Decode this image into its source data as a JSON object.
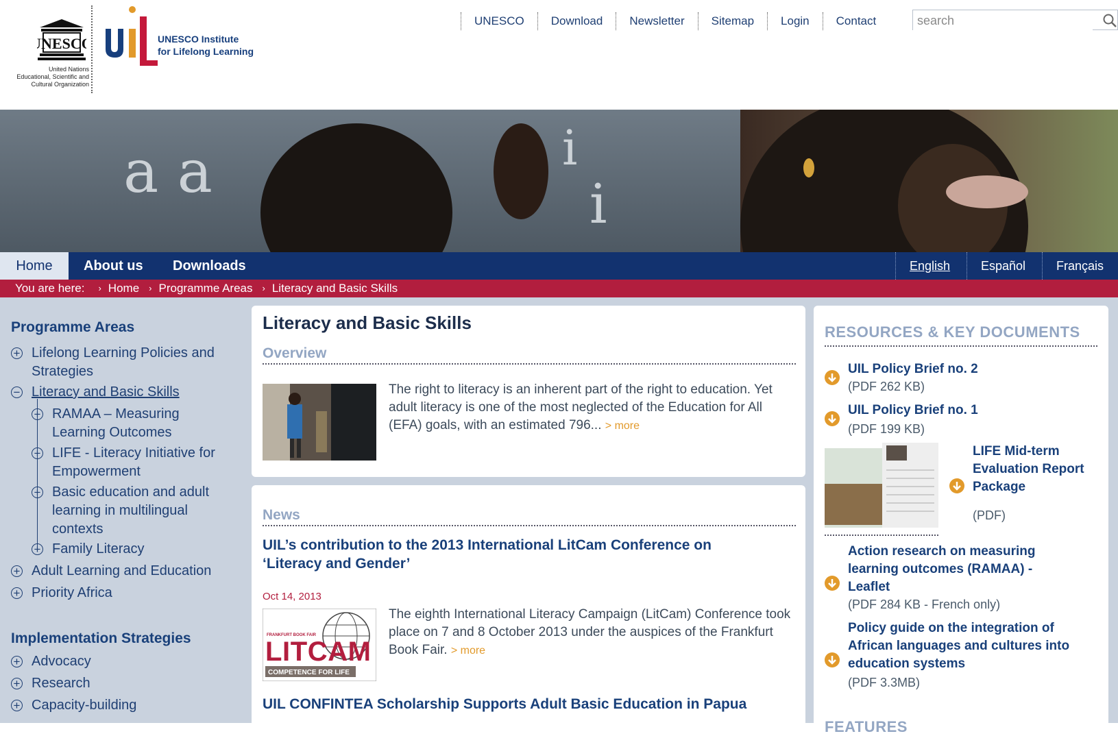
{
  "header": {
    "unesco_logo_text": "UNESCO",
    "unesco_subtitle": "United Nations\nEducational, Scientific and\nCultural Organization",
    "uil_logo_text": "uil",
    "uil_name": "UNESCO Institute\nfor Lifelong Learning",
    "topnav": [
      "UNESCO",
      "Download",
      "Newsletter",
      "Sitemap",
      "Login",
      "Contact"
    ],
    "search_placeholder": "search"
  },
  "mainnav": {
    "tabs": [
      "Home",
      "About us",
      "Downloads"
    ],
    "languages": [
      "English",
      "Español",
      "Français"
    ]
  },
  "breadcrumb": {
    "prefix": "You are here:",
    "items": [
      "Home",
      "Programme Areas",
      "Literacy and Basic Skills"
    ]
  },
  "sidebar": {
    "heading1": "Programme Areas",
    "items": [
      "Lifelong Learning Policies and Strategies",
      "Literacy and Basic Skills",
      "RAMAA – Measuring Learning Outcomes",
      "LIFE - Literacy Initiative for Empowerment",
      "Basic education and adult learning in multilingual contexts",
      "Family Literacy",
      "Adult Learning and Education",
      "Priority Africa"
    ],
    "heading2": "Implementation Strategies",
    "strategies": [
      "Advocacy",
      "Research",
      "Capacity-building"
    ]
  },
  "main": {
    "title": "Literacy and Basic Skills",
    "overview_label": "Overview",
    "overview_text": "The right to literacy is an inherent part of the right to education. Yet adult literacy is one of the most neglected of the Education for All (EFA) goals, with an estimated 796...",
    "more_label": "> more",
    "news_label": "News",
    "news": [
      {
        "title": "UIL’s contribution to the 2013 International LitCam Conference on ‘Literacy and Gender’",
        "date": "Oct 14, 2013",
        "text": "The eighth International Literacy Campaign (LitCam) Conference took place on 7 and 8 October 2013 under the auspices of the Frankfurt Book Fair.",
        "image_text": "LITCAM",
        "image_top": "FRANKFURT BOOK FAIR",
        "image_bottom": "COMPETENCE FOR LIFE"
      },
      {
        "title": "UIL CONFINTEA Scholarship Supports Adult Basic Education in Papua"
      }
    ]
  },
  "resources": {
    "heading": "RESOURCES & KEY DOCUMENTS",
    "items": [
      {
        "title": "UIL Policy Brief no. 2",
        "meta": "(PDF 262 KB)"
      },
      {
        "title": "UIL Policy Brief no. 1",
        "meta": "(PDF 199 KB)"
      },
      {
        "title": "LIFE Mid-term Evaluation Report Package",
        "meta": "(PDF)"
      },
      {
        "title": "Action research on measuring learning outcomes (RAMAA) - Leaflet",
        "meta": "(PDF 284 KB - French only)"
      },
      {
        "title": "Policy guide on the integration of African languages and cultures into education systems",
        "meta": "(PDF 3.3MB)"
      }
    ],
    "features_heading": "FEATURES"
  },
  "colors": {
    "navy": "#12326f",
    "breadcrumb_red": "#b21e3e",
    "link_blue": "#19407a",
    "accent_orange": "#e29a2b",
    "panel_bg": "#c9d2de"
  }
}
